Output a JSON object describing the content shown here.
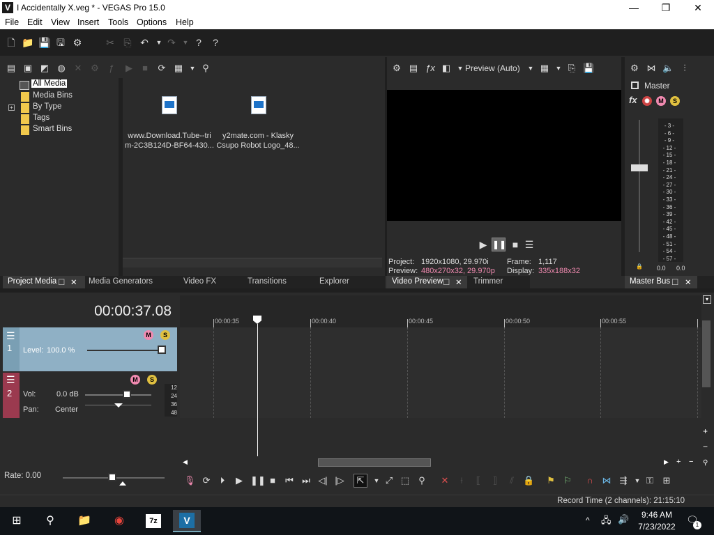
{
  "window": {
    "title": "I Accidentally X.veg * - VEGAS Pro 15.0",
    "logo": "V"
  },
  "menu": [
    "File",
    "Edit",
    "View",
    "Insert",
    "Tools",
    "Options",
    "Help"
  ],
  "project_media": {
    "tree": [
      "All Media",
      "Media Bins",
      "By Type",
      "Tags",
      "Smart Bins"
    ],
    "files": [
      {
        "line1": "www.Download.Tube--tri",
        "line2": "m-2C3B124D-BF64-430..."
      },
      {
        "line1": "y2mate.com - Klasky",
        "line2": "Csupo Robot Logo_48..."
      }
    ]
  },
  "left_tabs": [
    "Project Media",
    "Media Generators",
    "Video FX",
    "Transitions",
    "Explorer"
  ],
  "preview": {
    "mode": "Preview (Auto)",
    "project_label": "Project:",
    "project_value": "1920x1080, 29.970i",
    "preview_label": "Preview:",
    "preview_value": "480x270x32, 29.970p",
    "frame_label": "Frame:",
    "frame_value": "1,117",
    "display_label": "Display:",
    "display_value": "335x188x32",
    "tabs": [
      "Video Preview",
      "Trimmer"
    ]
  },
  "master": {
    "label": "Master",
    "scale": [
      "3",
      "6",
      "9",
      "12",
      "15",
      "18",
      "21",
      "24",
      "27",
      "30",
      "33",
      "36",
      "39",
      "42",
      "45",
      "48",
      "51",
      "54",
      "57"
    ],
    "left_value": "0.0",
    "right_value": "0.0",
    "tab": "Master Bus"
  },
  "timeline": {
    "timecode": "00:00:37.08",
    "ruler": [
      "00:00:35",
      "00:00:40",
      "00:00:45",
      "00:00:50",
      "00:00:55"
    ],
    "track1": {
      "number": "1",
      "level_label": "Level:",
      "level_value": "100.0 %",
      "level_fraction": 1.0
    },
    "track2": {
      "number": "2",
      "vol_label": "Vol:",
      "vol_value": "0.0 dB",
      "pan_label": "Pan:",
      "pan_value": "Center",
      "meter": [
        "12",
        "24",
        "36",
        "48"
      ]
    },
    "rate": "Rate: 0.00"
  },
  "status": {
    "record_time": "Record Time (2 channels): 21:15:10"
  },
  "taskbar": {
    "time": "9:46 AM",
    "date": "7/23/2022",
    "notification_count": "1",
    "app_7z": "7z"
  },
  "colors": {
    "accent_pink": "#f08ab0",
    "track1": "#7a9fb4",
    "track2": "#9b3a4f",
    "video_track_bg": "#8fb0c5"
  }
}
